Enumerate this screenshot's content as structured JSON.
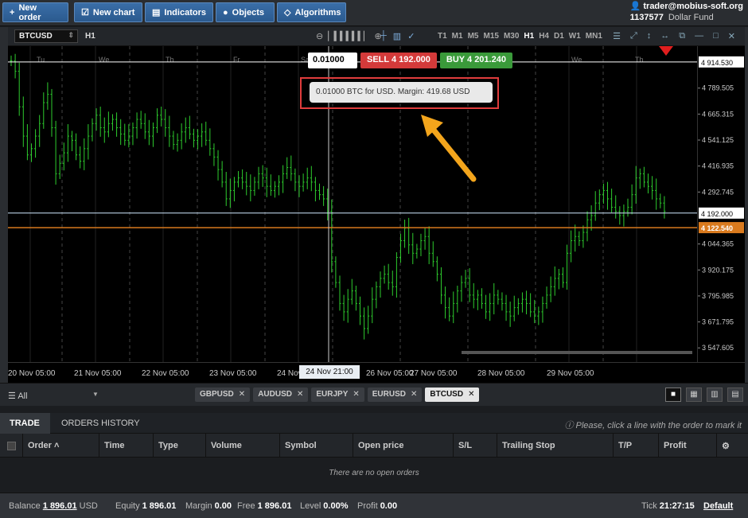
{
  "toolbar": {
    "new_order": "New order",
    "new_chart": "New chart",
    "indicators": "Indicators",
    "objects": "Objects",
    "algorithms": "Algorithms"
  },
  "account": {
    "email": "trader@mobius-soft.org",
    "number": "1137577",
    "fund": "Dollar Fund"
  },
  "chart_header": {
    "symbol": "BTCUSD",
    "timeframe": "H1",
    "timeframes": [
      "T1",
      "M1",
      "M5",
      "M15",
      "M30",
      "H1",
      "H4",
      "D1",
      "W1",
      "MN1"
    ],
    "active_timeframe": "H1"
  },
  "order_panel": {
    "quantity": "0.01000",
    "sell_label": "SELL",
    "sell_price": "4 192.000",
    "buy_label": "BUY",
    "buy_price": "4 201.240",
    "tooltip": "0.01000 BTC for USD. Margin: 419.68 USD"
  },
  "chart_data": {
    "type": "candlestick",
    "symbol": "BTCUSD",
    "timeframe": "H1",
    "y_ticks": [
      "4 914.530",
      "4 789.505",
      "4 665.315",
      "4 541.125",
      "4 416.935",
      "4 292.745",
      "4 192.000",
      "4 122.540",
      "4 044.365",
      "3 920.175",
      "3 795.985",
      "3 671.795",
      "3 547.605"
    ],
    "y_tick_values": [
      4914.53,
      4789.505,
      4665.315,
      4541.125,
      4416.935,
      4292.745,
      4168.555,
      4044.365,
      3920.175,
      3795.985,
      3671.795,
      3547.605
    ],
    "ylim": [
      3480,
      4990
    ],
    "day_labels": [
      "Tu",
      "We",
      "Th",
      "Fr",
      "Sa",
      "We",
      "Th"
    ],
    "x_labels": [
      "20 Nov 05:00",
      "21 Nov 05:00",
      "22 Nov 05:00",
      "23 Nov 05:00",
      "24 Nov 05:00",
      "26 Nov 05:00",
      "27 Nov 05:00",
      "28 Nov 05:00",
      "29 Nov 05:00"
    ],
    "crosshair_time": "24 Nov 21:00",
    "lines": {
      "high_line": 4914.53,
      "bid_line": 4192.0,
      "orange_line": 4122.54
    },
    "line_labels": {
      "high_line": "4 914.530",
      "bid_line": "4 192.000",
      "orange_line": "4 122.540"
    },
    "colors": {
      "candle": "#2ecc2e",
      "bid_line": "#cfe8ff",
      "orange_line": "#d97a1e",
      "background": "#000000"
    },
    "closes": [
      4920,
      4870,
      4700,
      4560,
      4470,
      4500,
      4560,
      4620,
      4720,
      4760,
      4600,
      4380,
      4430,
      4480,
      4560,
      4540,
      4470,
      4440,
      4500,
      4560,
      4620,
      4660,
      4600,
      4580,
      4620,
      4640,
      4600,
      4570,
      4540,
      4560,
      4600,
      4640,
      4620,
      4580,
      4560,
      4600,
      4660,
      4640,
      4600,
      4560,
      4520,
      4540,
      4580,
      4600,
      4570,
      4540,
      4560,
      4580,
      4540,
      4500,
      4460,
      4400,
      4340,
      4260,
      4300,
      4340,
      4360,
      4340,
      4320,
      4300,
      4340,
      4380,
      4360,
      4320,
      4300,
      4320,
      4340,
      4380,
      4410,
      4380,
      4340,
      4320,
      4340,
      4360,
      4340,
      4300,
      4280,
      4260,
      4200,
      3960,
      3860,
      3760,
      3720,
      3780,
      3820,
      3760,
      3700,
      3640,
      3700,
      3780,
      3840,
      3880,
      3900,
      3860,
      3840,
      3980,
      4060,
      4120,
      4040,
      4000,
      4020,
      4060,
      4080,
      4000,
      3960,
      3900,
      3800,
      3740,
      3700,
      3760,
      3820,
      3860,
      3880,
      3800,
      3780,
      3800,
      3760,
      3720,
      3760,
      3800,
      3780,
      3760,
      3720,
      3700,
      3740,
      3760,
      3780,
      3760,
      3720,
      3700,
      3720,
      3760,
      3800,
      3840,
      3880,
      3900,
      3860,
      4000,
      4060,
      4080,
      4060,
      4100,
      4160,
      4180,
      4240,
      4280,
      4300,
      4260,
      4220,
      4200,
      4180,
      4200,
      4220,
      4280,
      4360,
      4380,
      4340,
      4320,
      4300,
      4260,
      4240,
      4200
    ]
  },
  "symbol_tabs": {
    "filter": "All",
    "tabs": [
      "GBPUSD",
      "AUDUSD",
      "EURJPY",
      "EURUSD",
      "BTCUSD"
    ],
    "active": "BTCUSD"
  },
  "trade_panel": {
    "tabs": [
      "TRADE",
      "ORDERS HISTORY"
    ],
    "hint": "Please, click a line with the order to mark it",
    "columns": [
      "Order",
      "Time",
      "Type",
      "Volume",
      "Symbol",
      "Open price",
      "S/L",
      "Trailing Stop",
      "T/P",
      "Profit"
    ],
    "empty_message": "There are no open orders"
  },
  "status": {
    "balance_label": "Balance",
    "balance": "1 896.01",
    "currency": "USD",
    "equity_label": "Equity",
    "equity": "1 896.01",
    "margin_label": "Margin",
    "margin": "0.00",
    "free_label": "Free",
    "free": "1 896.01",
    "level_label": "Level",
    "level": "0.00%",
    "profit_label": "Profit",
    "profit": "0.00",
    "tick_label": "Tick",
    "tick": "21:27:15",
    "profile": "Default"
  }
}
